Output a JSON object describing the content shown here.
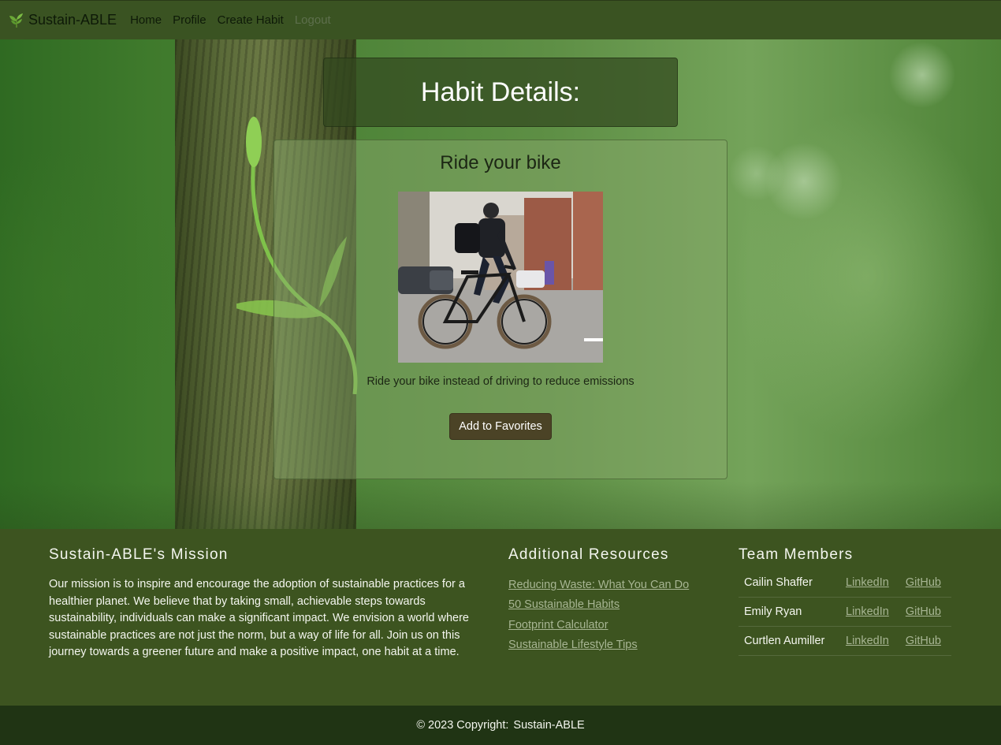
{
  "navbar": {
    "brand": "Sustain-ABLE",
    "brand_icon": "leaf-icon",
    "links": [
      "Home",
      "Profile",
      "Create Habit",
      "Logout"
    ]
  },
  "header": {
    "title": "Habit Details:"
  },
  "habit": {
    "title": "Ride your bike",
    "description": "Ride your bike instead of driving to reduce emissions",
    "favorite_button": "Add to Favorites"
  },
  "footer": {
    "mission": {
      "heading": "Sustain-ABLE's Mission",
      "text": "Our mission is to inspire and encourage the adoption of sustainable practices for a healthier planet. We believe that by taking small, achievable steps towards sustainability, individuals can make a significant impact. We envision a world where sustainable practices are not just the norm, but a way of life for all. Join us on this journey towards a greener future and make a positive impact, one habit at a time."
    },
    "resources": {
      "heading": "Additional Resources",
      "links": [
        "Reducing Waste: What You Can Do",
        "50 Sustainable Habits",
        "Footprint Calculator",
        "Sustainable Lifestyle Tips"
      ]
    },
    "team": {
      "heading": "Team Members",
      "members": [
        {
          "name": "Cailin Shaffer",
          "linkedin": "LinkedIn",
          "github": "GitHub"
        },
        {
          "name": "Emily Ryan",
          "linkedin": "LinkedIn",
          "github": "GitHub"
        },
        {
          "name": "Curtlen Aumiller",
          "linkedin": "LinkedIn",
          "github": "GitHub"
        }
      ]
    },
    "copyright": {
      "text": "© 2023 Copyright:",
      "link": "Sustain-ABLE"
    }
  },
  "colors": {
    "navbar": "#3a5322",
    "footer": "#3d5420",
    "copyright_bar": "#203414",
    "button": "#4b4326",
    "link": "#a7b593"
  }
}
